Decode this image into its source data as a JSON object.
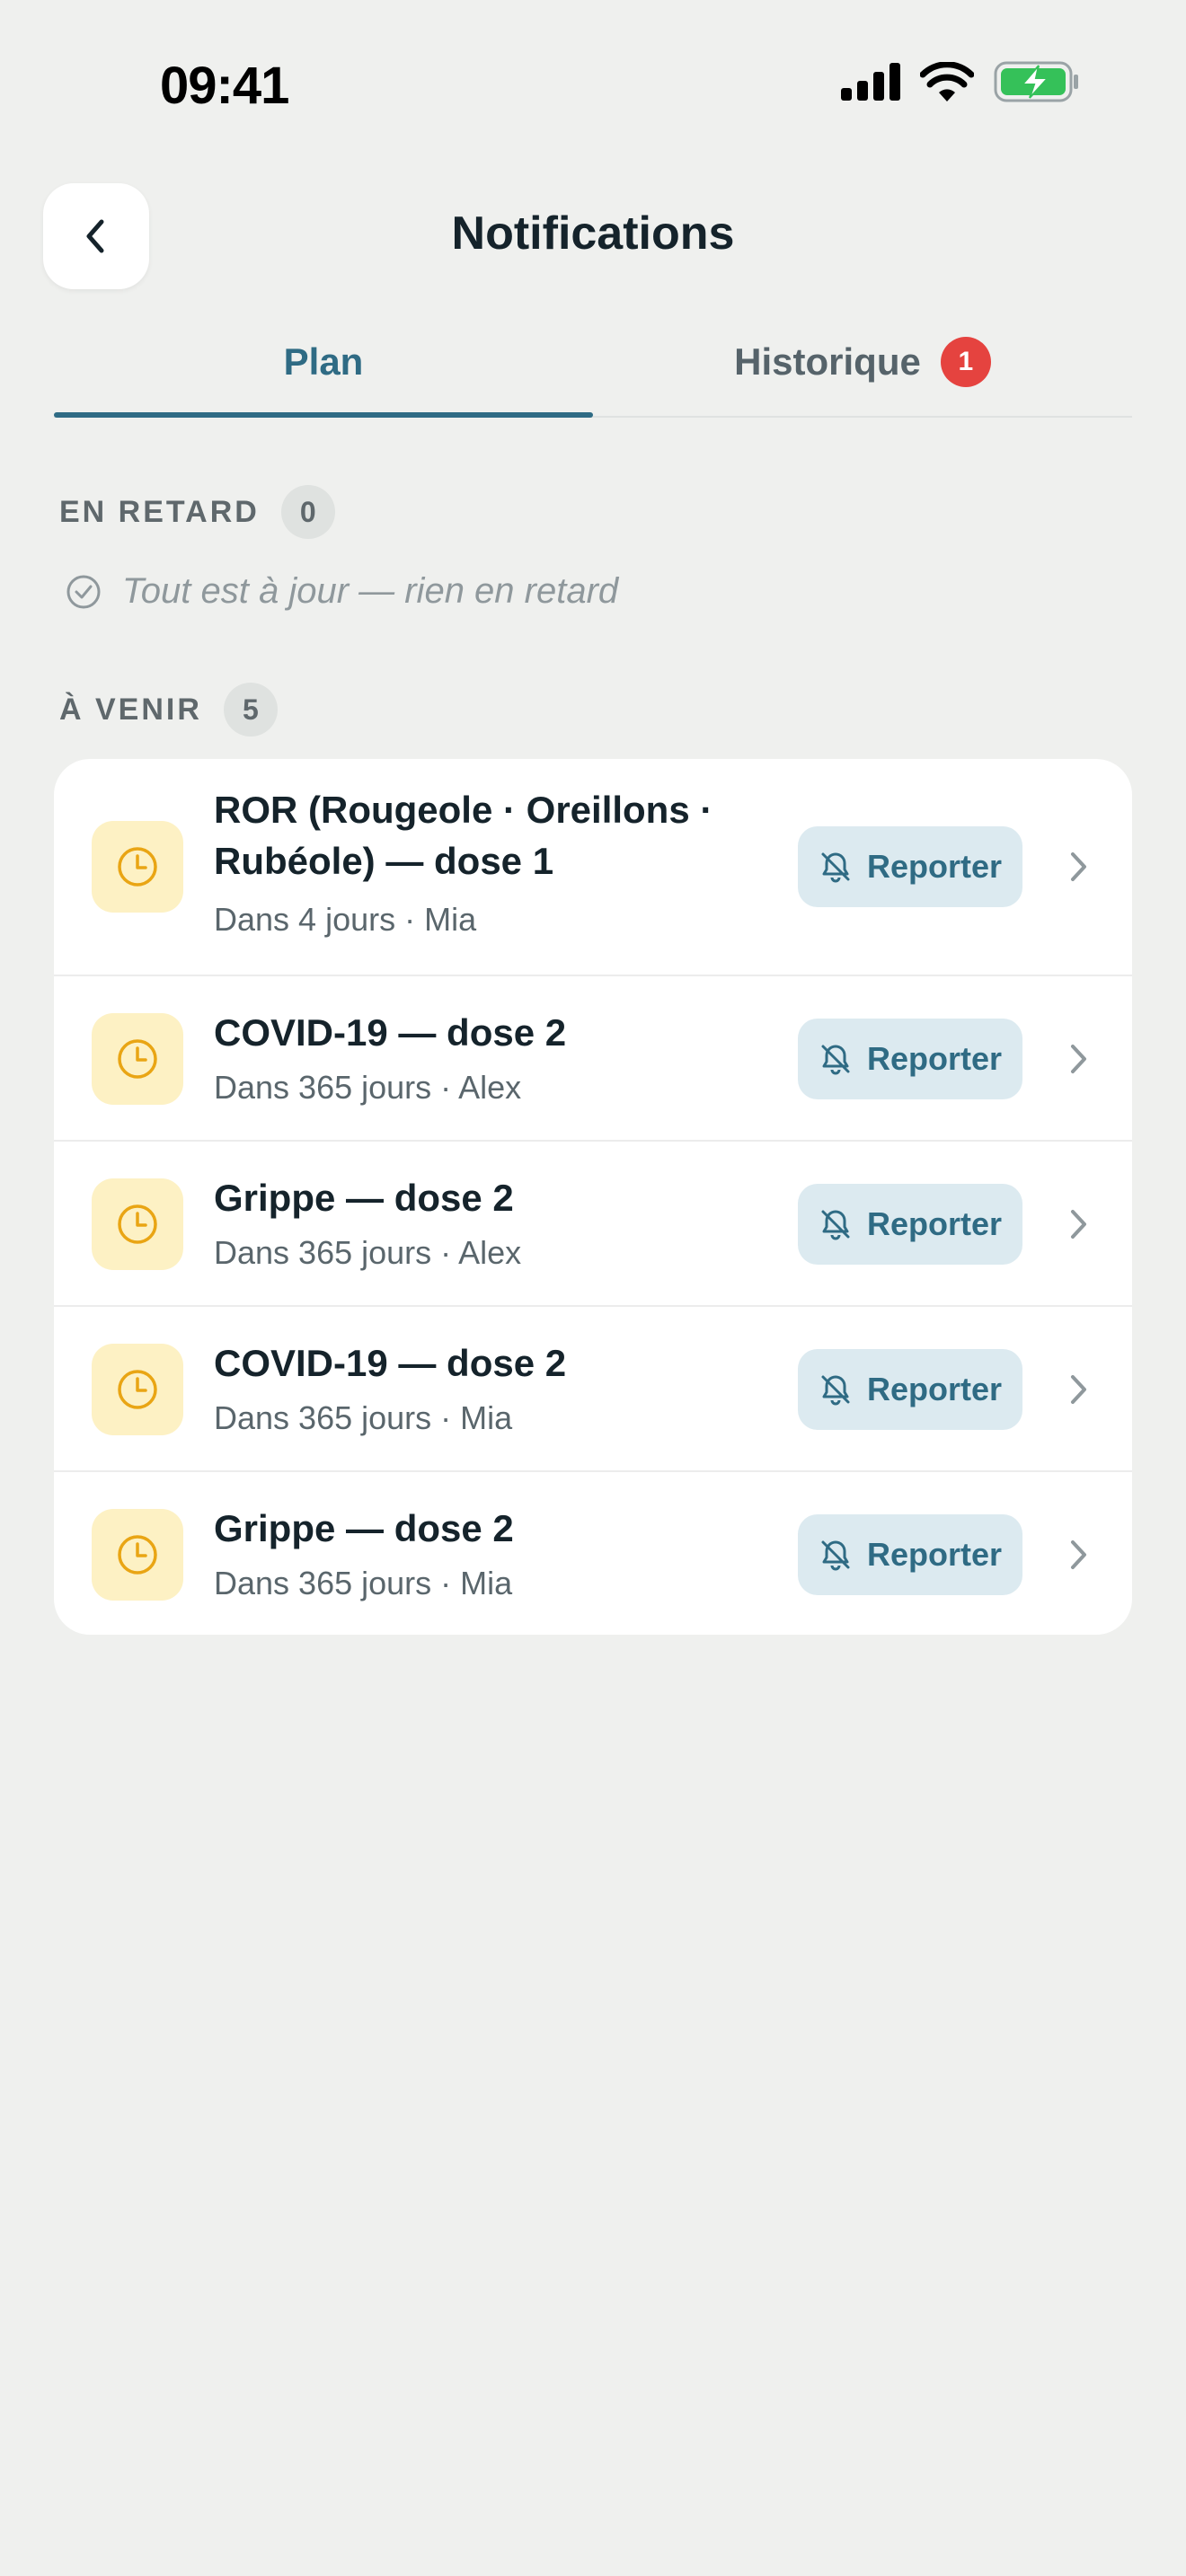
{
  "status_bar": {
    "time": "09:41"
  },
  "header": {
    "title": "Notifications"
  },
  "tabs": [
    {
      "label": "Plan",
      "active": true
    },
    {
      "label": "Historique",
      "badge": "1",
      "active": false
    }
  ],
  "overdue": {
    "label": "EN RETARD",
    "count": "0",
    "empty_message": "Tout est à jour — rien en retard"
  },
  "upcoming": {
    "label": "À VENIR",
    "count": "5",
    "action_label": "Reporter",
    "items": [
      {
        "title": "ROR (Rougeole · Oreillons · Rubéole) — dose 1",
        "subtitle": "Dans 4 jours · Mia"
      },
      {
        "title": "COVID-19 — dose 2",
        "subtitle": "Dans 365 jours · Alex"
      },
      {
        "title": "Grippe — dose 2",
        "subtitle": "Dans 365 jours · Alex"
      },
      {
        "title": "COVID-19 — dose 2",
        "subtitle": "Dans 365 jours · Mia"
      },
      {
        "title": "Grippe — dose 2",
        "subtitle": "Dans 365 jours · Mia"
      }
    ]
  },
  "icons": {
    "row_icon": "clock-icon",
    "action_icon": "bell-off-icon",
    "row_nav": "chevron-right-icon"
  },
  "colors": {
    "accent": "#2f6b84",
    "badge": "#e5433f",
    "pending_icon": "#e9a514",
    "pending_icon_bg": "#fdf1c4",
    "background": "#eff0ee"
  }
}
